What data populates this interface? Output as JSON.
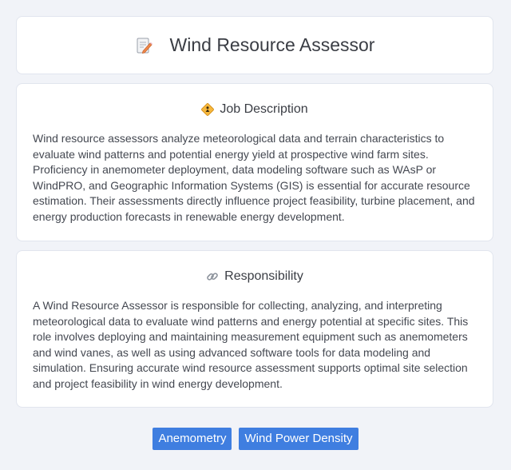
{
  "header": {
    "title": "Wind Resource Assessor",
    "icon": "memo-pencil-icon"
  },
  "job_description": {
    "heading": "Job Description",
    "icon": "diamond-person-icon",
    "text": "Wind resource assessors analyze meteorological data and terrain characteristics to evaluate wind patterns and potential energy yield at prospective wind farm sites. Proficiency in anemometer deployment, data modeling software such as WAsP or WindPRO, and Geographic Information Systems (GIS) is essential for accurate resource estimation. Their assessments directly influence project feasibility, turbine placement, and energy production forecasts in renewable energy development."
  },
  "responsibility": {
    "heading": "Responsibility",
    "icon": "link-icon",
    "text": "A Wind Resource Assessor is responsible for collecting, analyzing, and interpreting meteorological data to evaluate wind patterns and energy potential at specific sites. This role involves deploying and maintaining measurement equipment such as anemometers and wind vanes, as well as using advanced software tools for data modeling and simulation. Ensuring accurate wind resource assessment supports optimal site selection and project feasibility in wind energy development."
  },
  "tags": [
    "Anemometry",
    "Wind Power Density"
  ],
  "colors": {
    "background": "#f1f3f8",
    "card": "#ffffff",
    "tag": "#3f7ee0"
  }
}
